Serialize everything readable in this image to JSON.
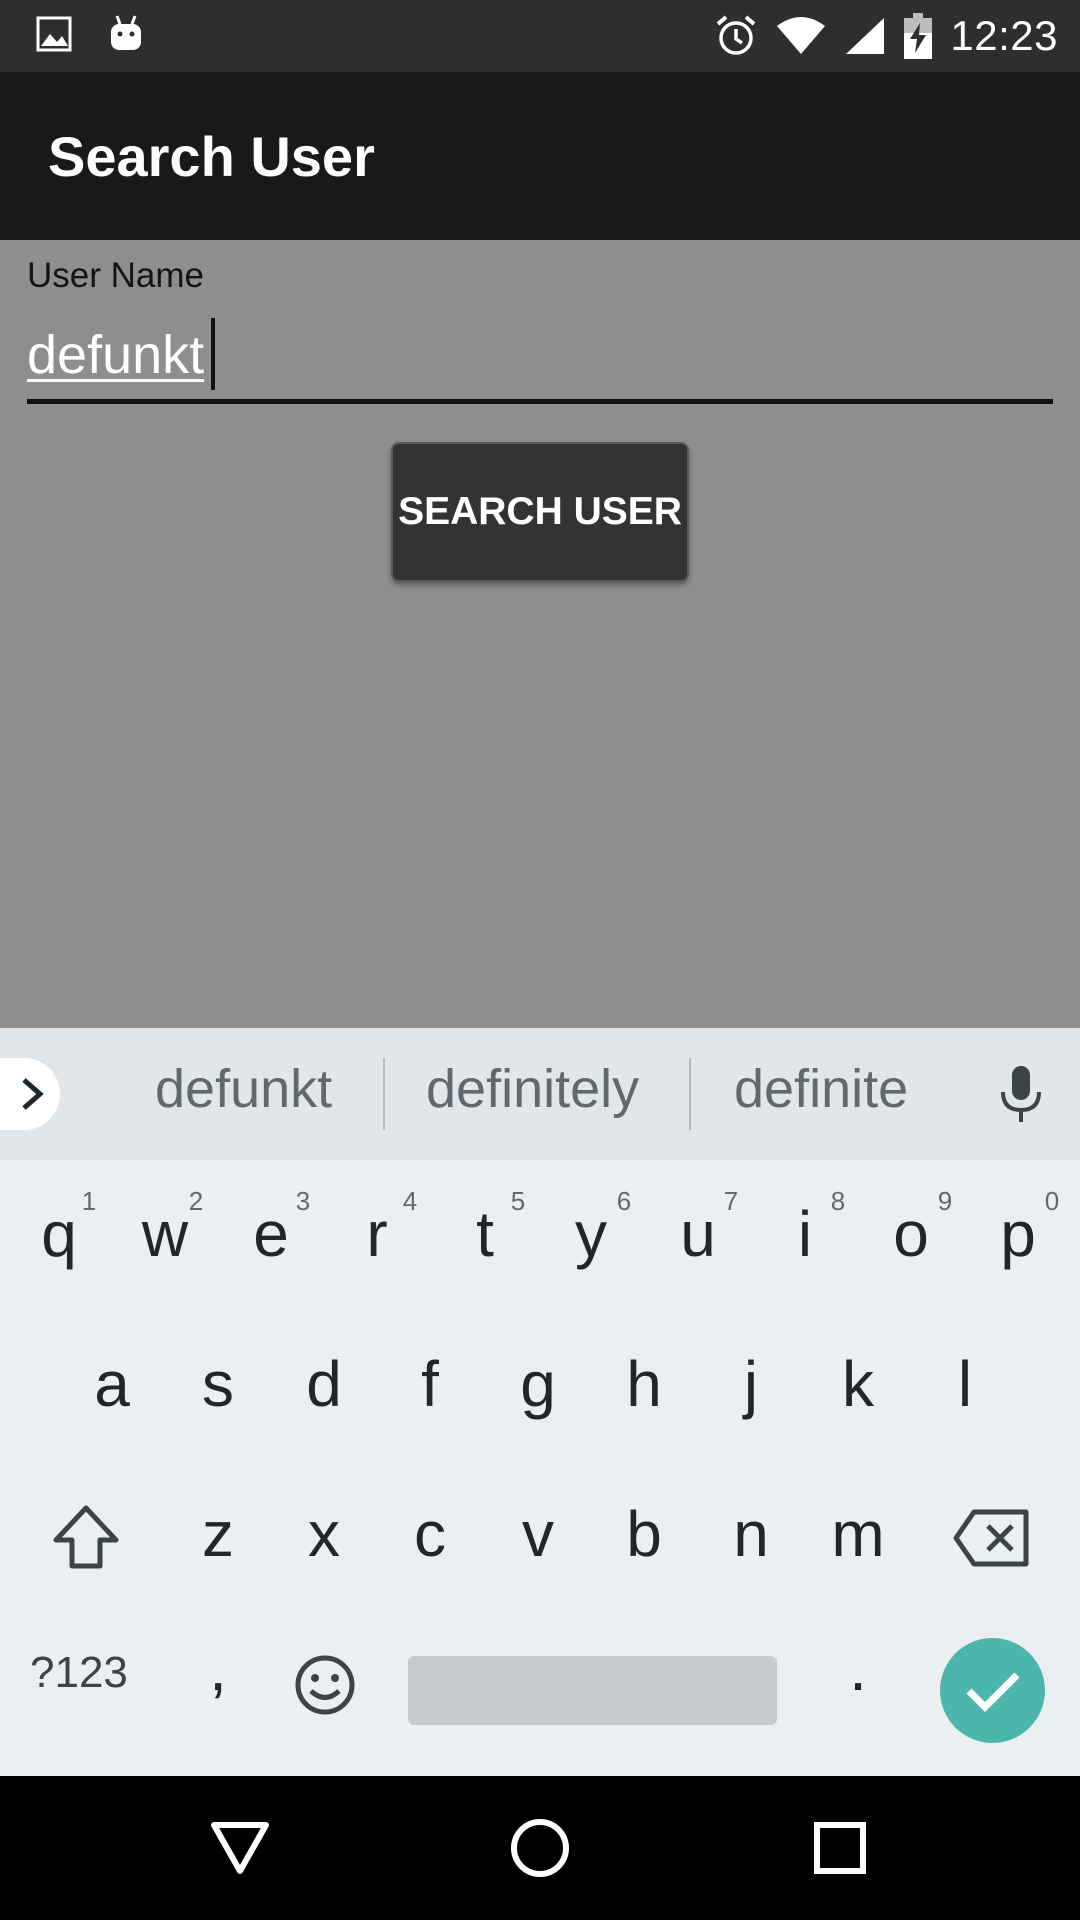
{
  "status_bar": {
    "time": "12:23",
    "left_icons": [
      "image-icon",
      "android-icon"
    ],
    "right_icons": [
      "alarm-icon",
      "wifi-icon",
      "signal-icon",
      "battery-charging-icon"
    ]
  },
  "app_bar": {
    "title": "Search User"
  },
  "form": {
    "label": "User Name",
    "value": "defunkt",
    "button_label": "SEARCH USER"
  },
  "keyboard": {
    "suggestions": [
      "defunkt",
      "definitely",
      "definite"
    ],
    "row1": [
      "q",
      "w",
      "e",
      "r",
      "t",
      "y",
      "u",
      "i",
      "o",
      "p"
    ],
    "row1_hints": [
      "1",
      "2",
      "3",
      "4",
      "5",
      "6",
      "7",
      "8",
      "9",
      "0"
    ],
    "row2": [
      "a",
      "s",
      "d",
      "f",
      "g",
      "h",
      "j",
      "k",
      "l"
    ],
    "row3": [
      "z",
      "x",
      "c",
      "v",
      "b",
      "n",
      "m"
    ],
    "symbols_label": "?123",
    "comma": ",",
    "period": ".",
    "accent_color": "#4db6ac"
  },
  "nav_bar": {
    "icons": [
      "back-icon",
      "home-icon",
      "recents-icon"
    ]
  }
}
